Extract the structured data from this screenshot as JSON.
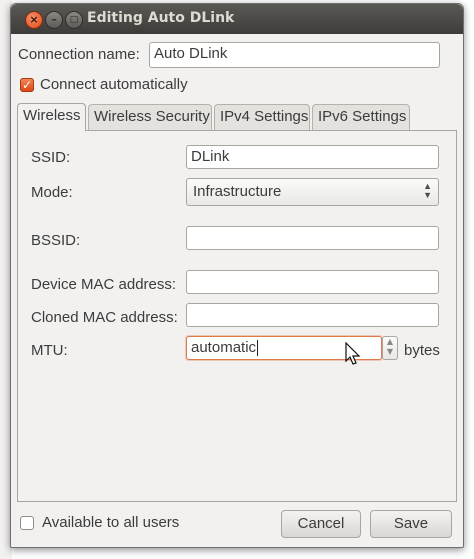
{
  "window": {
    "title": "Editing Auto DLink"
  },
  "connection": {
    "name_label": "Connection name:",
    "name_value": "Auto DLink",
    "connect_auto_label": "Connect automatically",
    "connect_auto_checked": true
  },
  "tabs": [
    {
      "label": "Wireless",
      "active": true
    },
    {
      "label": "Wireless Security",
      "active": false
    },
    {
      "label": "IPv4 Settings",
      "active": false
    },
    {
      "label": "IPv6 Settings",
      "active": false
    }
  ],
  "wireless": {
    "ssid_label": "SSID:",
    "ssid_value": "DLink",
    "mode_label": "Mode:",
    "mode_value": "Infrastructure",
    "bssid_label": "BSSID:",
    "bssid_value": "",
    "device_mac_label": "Device MAC address:",
    "device_mac_value": "",
    "cloned_mac_label": "Cloned MAC address:",
    "cloned_mac_value": "",
    "mtu_label": "MTU:",
    "mtu_value": "automatic",
    "mtu_unit": "bytes"
  },
  "footer": {
    "all_users_label": "Available to all users",
    "all_users_checked": false,
    "cancel_label": "Cancel",
    "save_label": "Save"
  },
  "icons": [
    "close-icon",
    "minimize-icon",
    "maximize-icon",
    "check-icon",
    "combo-arrows-icon",
    "spin-up-icon",
    "spin-down-icon",
    "mouse-pointer-icon"
  ],
  "colors": {
    "accent": "#dd4814",
    "titlebar": "#3d3c38",
    "window_bg": "#f2f1f0"
  }
}
